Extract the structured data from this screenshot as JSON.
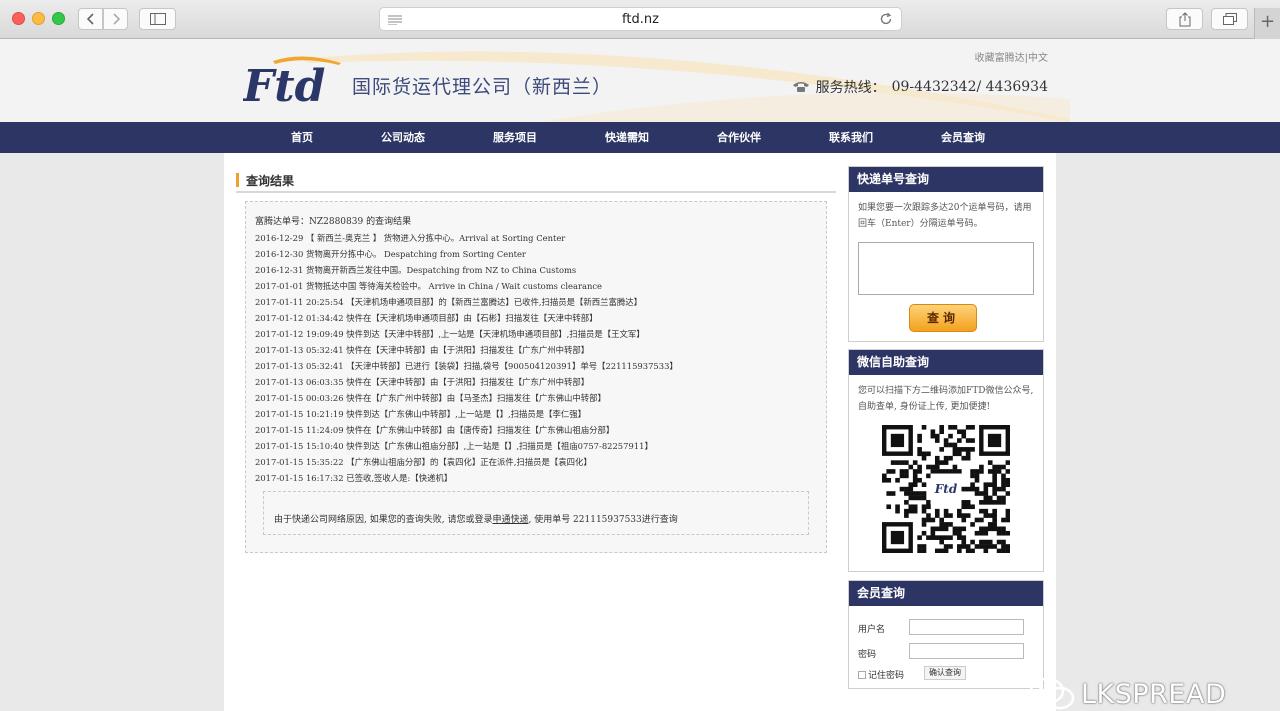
{
  "browser": {
    "url": "ftd.nz"
  },
  "header": {
    "company_name": "国际货运代理公司（新西兰）",
    "favorite_link": "收藏富腾达",
    "separator": "|",
    "language_link": "中文",
    "hotline_label": "服务热线：",
    "hotline_number": "09-4432342/ 4436934"
  },
  "nav": {
    "items": [
      "首页",
      "公司动态",
      "服务项目",
      "快递需知",
      "合作伙伴",
      "联系我们",
      "会员查询"
    ]
  },
  "main": {
    "title": "查询结果",
    "result_heading": "富腾达单号：NZ2880839 的查询结果",
    "tracking": [
      "2016-12-29 【 新西兰-奥克兰 】 货物进入分拣中心。Arrival at Sorting Center",
      "2016-12-30 货物离开分拣中心。 Despatching from Sorting Center",
      "2016-12-31 货物离开新西兰发往中国。Despatching from NZ to China Customs",
      "2017-01-01 货物抵达中国 等待海关检验中。 Arrive in China / Wait customs clearance",
      "2017-01-11 20:25:54 【天津机场申通项目部】的【新西兰富腾达】已收件,扫描员是【新西兰富腾达】",
      "2017-01-12 01:34:42 快件在【天津机场申通项目部】由【石彬】扫描发往【天津中转部】",
      "2017-01-12 19:09:49 快件到达【天津中转部】,上一站是【天津机场申通项目部】,扫描员是【王文军】",
      "2017-01-13 05:32:41 快件在【天津中转部】由【于洪阳】扫描发往【广东广州中转部】",
      "2017-01-13 05:32:41 【天津中转部】已进行【装袋】扫描,袋号【900504120391】单号【221115937533】",
      "2017-01-13 06:03:35 快件在【天津中转部】由【于洪阳】扫描发往【广东广州中转部】",
      "2017-01-15 00:03:26 快件在【广东广州中转部】由【马圣杰】扫描发往【广东佛山中转部】",
      "2017-01-15 10:21:19 快件到达【广东佛山中转部】,上一站是【】,扫描员是【李仁强】",
      "2017-01-15 11:24:09 快件在【广东佛山中转部】由【唐传奇】扫描发往【广东佛山祖庙分部】",
      "2017-01-15 15:10:40 快件到达【广东佛山祖庙分部】,上一站是【】,扫描员是【祖庙0757-82257911】",
      "2017-01-15 15:35:22 【广东佛山祖庙分部】的【袁四化】正在派件,扫描员是【袁四化】",
      "2017-01-15 16:17:32 已签收,签收人是:【快递机】"
    ],
    "note_prefix": "由于快递公司网络原因, 如果您的查询失败, 请您或登录",
    "note_link": "申通快递",
    "note_suffix": ", 使用单号 221115937533进行查询"
  },
  "sidebar": {
    "express_title": "快递单号查询",
    "express_desc": "如果您要一次跟踪多达20个运单号码，请用回车（Enter）分隔运单号码。",
    "query_button": "查询",
    "wechat_title": "微信自助查询",
    "wechat_desc": "您可以扫描下方二维码添加FTD微信公众号, 自助查单, 身份证上传, 更加便捷!",
    "member_title": "会员查询",
    "username_label": "用户名",
    "password_label": "密码",
    "remember_label": "记住密码",
    "confirm_button": "确认查询"
  },
  "watermark": {
    "text": "LKSPREAD"
  }
}
